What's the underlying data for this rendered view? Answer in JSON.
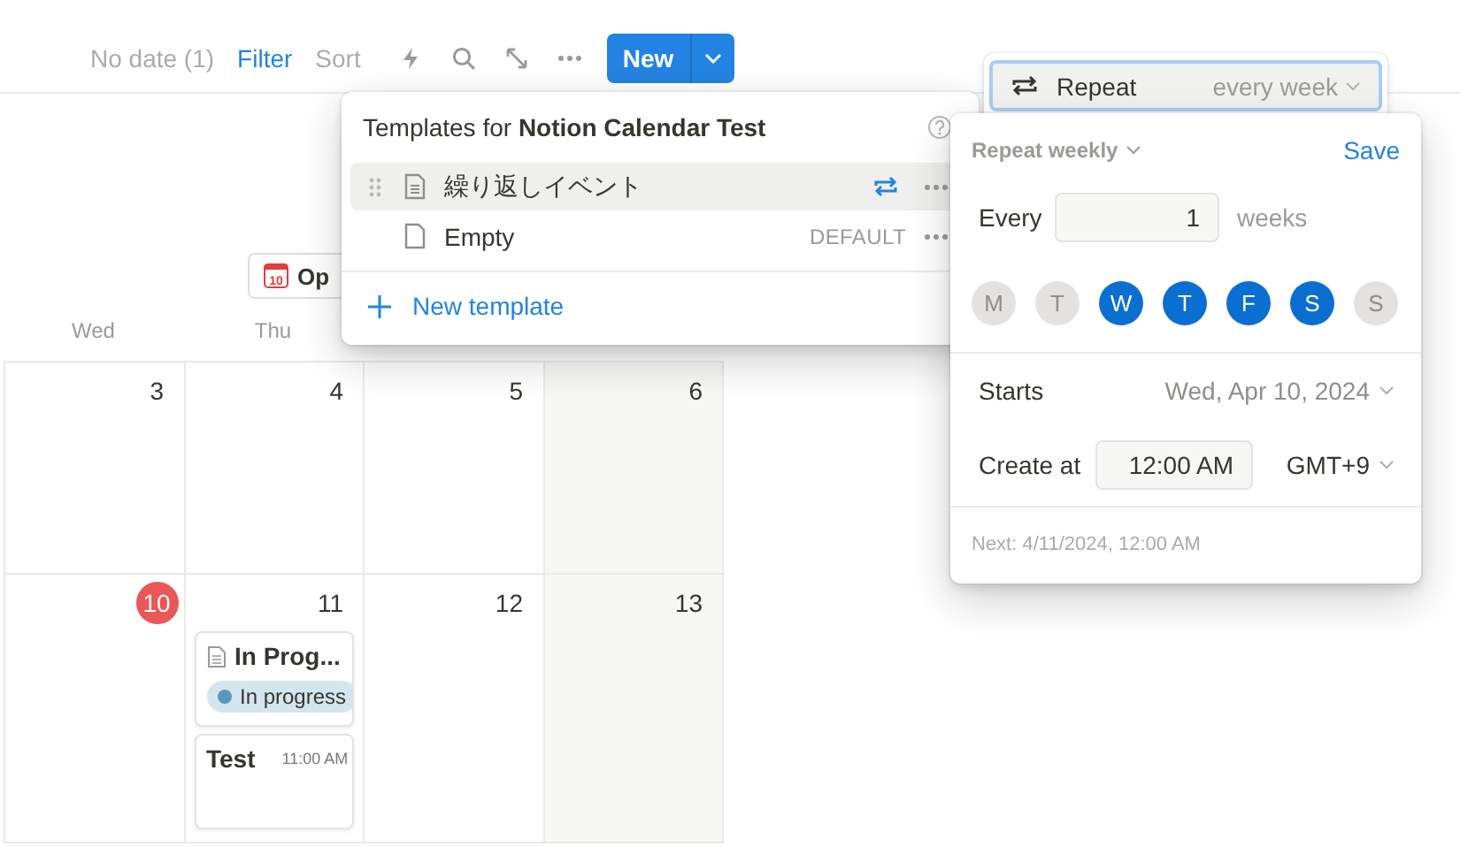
{
  "toolbar": {
    "no_date": "No date (1)",
    "filter": "Filter",
    "sort": "Sort",
    "new_button": "New"
  },
  "open_button": {
    "icon_text": "10",
    "label": "Op"
  },
  "calendar": {
    "weekdays": [
      "Wed",
      "Thu"
    ],
    "weeks": [
      {
        "days": [
          {
            "date": "3",
            "today": false,
            "weekend": false
          },
          {
            "date": "4",
            "today": false,
            "weekend": false
          },
          {
            "date": "5",
            "today": false,
            "weekend": false
          },
          {
            "date": "6",
            "today": false,
            "weekend": true
          }
        ]
      },
      {
        "days": [
          {
            "date": "10",
            "today": true,
            "weekend": false
          },
          {
            "date": "11",
            "today": false,
            "weekend": false,
            "events": [
              {
                "kind": "page",
                "title": "In Prog...",
                "status": {
                  "label": "In progress",
                  "color": "#5b97bd"
                }
              },
              {
                "kind": "timed",
                "title": "Test",
                "time": "11:00 AM"
              }
            ]
          },
          {
            "date": "12",
            "today": false,
            "weekend": false
          },
          {
            "date": "13",
            "today": false,
            "weekend": true
          }
        ]
      }
    ]
  },
  "templates_menu": {
    "title": "Templates for **Notion Calendar Test**",
    "items": [
      {
        "name": "繰り返しイベント",
        "selected": true,
        "repeating": true
      },
      {
        "name": "Empty",
        "selected": false,
        "repeating": false,
        "badge": "DEFAULT"
      }
    ],
    "new_template": "New template"
  },
  "repeat_field": {
    "label": "Repeat",
    "value": "every week"
  },
  "repeat_popup": {
    "mode": "Repeat weekly",
    "save": "Save",
    "every_label": "Every",
    "every_value": "1",
    "unit": "weeks",
    "days": [
      {
        "label": "M",
        "selected": false
      },
      {
        "label": "T",
        "selected": false
      },
      {
        "label": "W",
        "selected": true
      },
      {
        "label": "T",
        "selected": true
      },
      {
        "label": "F",
        "selected": true
      },
      {
        "label": "S",
        "selected": true
      },
      {
        "label": "S",
        "selected": false
      }
    ],
    "starts_label": "Starts",
    "starts_value": "Wed, Apr 10, 2024",
    "create_label": "Create at",
    "create_time": "12:00 AM",
    "timezone": "GMT+9",
    "next": "Next: 4/11/2024, 12:00 AM"
  }
}
